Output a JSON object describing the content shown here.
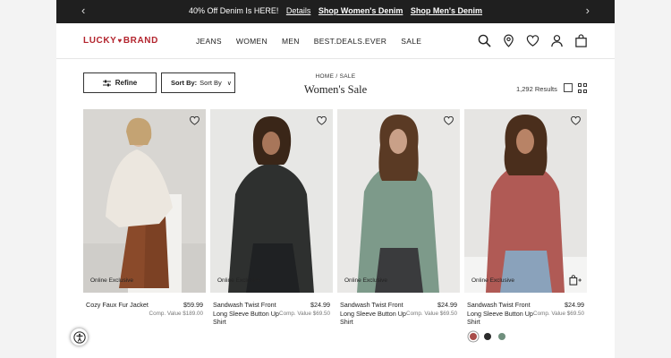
{
  "promo": {
    "text": "40% Off Denim Is HERE!",
    "details_link": "Details",
    "link_women": "Shop Women's Denim",
    "link_men": "Shop Men's Denim"
  },
  "brand": {
    "logo_left": "LUCKY",
    "logo_right": "BRAND",
    "color": "#b3252e"
  },
  "nav": {
    "items": [
      "JEANS",
      "WOMEN",
      "MEN",
      "BEST.DEALS.EVER",
      "SALE"
    ]
  },
  "header_icons": [
    "search-icon",
    "location-icon",
    "wishlist-heart-icon",
    "account-icon",
    "bag-icon"
  ],
  "controls": {
    "refine_label": "Refine",
    "sort_label": "Sort By:",
    "sort_value": "Sort By"
  },
  "breadcrumb": {
    "home": "HOME",
    "separator": "/",
    "current": "SALE"
  },
  "page_title": "Women's Sale",
  "results_count": "1,292 Results",
  "products": [
    {
      "name": "Cozy Faux Fur Jacket",
      "price": "$59.99",
      "comp": "Comp. Value $189.00",
      "badge": "Online Exclusive"
    },
    {
      "name": "Sandwash Twist Front Long Sleeve Button Up Shirt",
      "price": "$24.99",
      "comp": "Comp. Value $69.50",
      "badge": "Online Exclusive"
    },
    {
      "name": "Sandwash Twist Front Long Sleeve Button Up Shirt",
      "price": "$24.99",
      "comp": "Comp. Value $69.50",
      "badge": "Online Exclusive"
    },
    {
      "name": "Sandwash Twist Front Long Sleeve Button Up Shirt",
      "price": "$24.99",
      "comp": "Comp. Value $69.50",
      "badge": "Online Exclusive"
    }
  ],
  "swatch_colors": [
    "#a94d4a",
    "#2b2b2b",
    "#6f8f7d"
  ]
}
